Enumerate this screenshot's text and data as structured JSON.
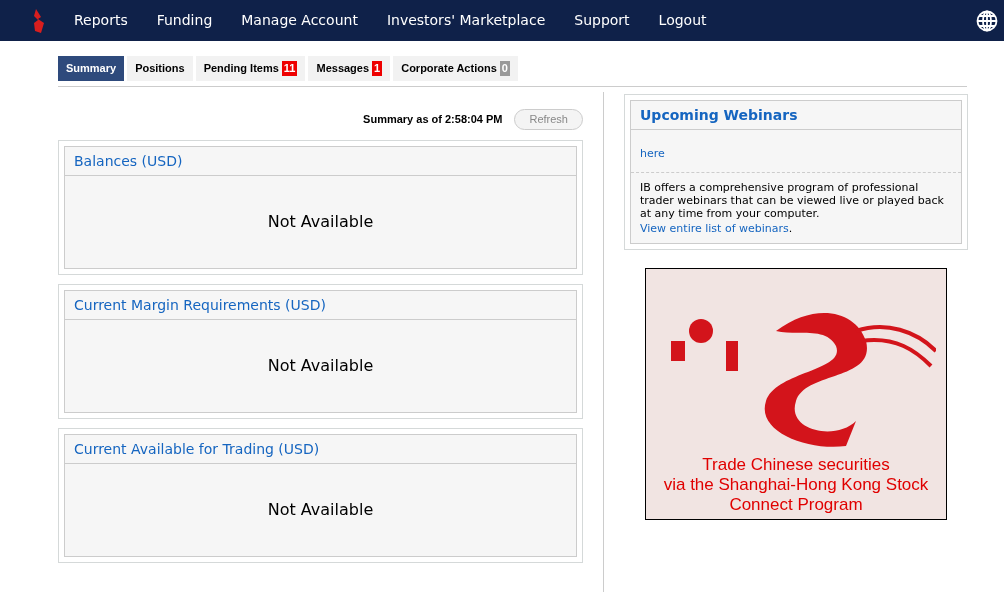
{
  "nav": {
    "items": [
      "Reports",
      "Funding",
      "Manage Account",
      "Investors' Marketplace",
      "Support",
      "Logout"
    ]
  },
  "tabs": [
    {
      "label": "Summary",
      "selected": true
    },
    {
      "label": "Positions",
      "selected": false
    },
    {
      "label": "Pending Items",
      "selected": false,
      "badge": "11",
      "color": "#ee0000"
    },
    {
      "label": "Messages",
      "selected": false,
      "badge": "1",
      "color": "#ee0000"
    },
    {
      "label": "Corporate Actions",
      "selected": false,
      "badge": "0",
      "color": "#999999"
    }
  ],
  "summary": {
    "as_of": "Summary as of 2:58:04 PM",
    "refresh": "Refresh"
  },
  "panels": [
    {
      "title": "Balances (USD)",
      "body": "Not Available"
    },
    {
      "title": "Current Margin Requirements (USD)",
      "body": "Not Available"
    },
    {
      "title": "Current Available for Trading (USD)",
      "body": "Not Available"
    }
  ],
  "webinars": {
    "title": "Upcoming Webinars",
    "link": "here",
    "text": "IB offers a comprehensive program of professional trader webinars that can be viewed live or played back at any time from your computer.",
    "list_link": "View entire list of webinars",
    "list_suffix": "."
  },
  "banner": {
    "lines": [
      "Trade Chinese securities",
      "via the Shanghai-Hong Kong Stock",
      "Connect Program"
    ]
  }
}
